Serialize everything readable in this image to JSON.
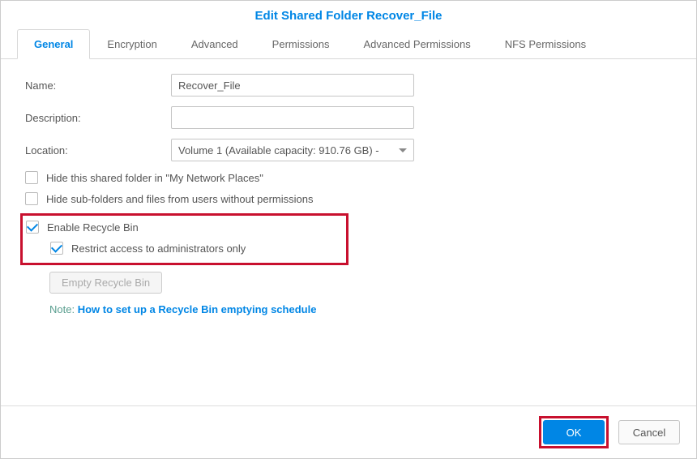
{
  "dialog": {
    "title": "Edit Shared Folder Recover_File"
  },
  "tabs": {
    "general": "General",
    "encryption": "Encryption",
    "advanced": "Advanced",
    "permissions": "Permissions",
    "advanced_permissions": "Advanced Permissions",
    "nfs_permissions": "NFS Permissions"
  },
  "form": {
    "name_label": "Name:",
    "name_value": "Recover_File",
    "description_label": "Description:",
    "description_value": "",
    "location_label": "Location:",
    "location_value": "Volume 1 (Available capacity: 910.76 GB) -"
  },
  "checkboxes": {
    "hide_network": "Hide this shared folder in \"My Network Places\"",
    "hide_subfolders": "Hide sub-folders and files from users without permissions",
    "enable_recycle": "Enable Recycle Bin",
    "restrict_admin": "Restrict access to administrators only"
  },
  "buttons": {
    "empty_recycle": "Empty Recycle Bin",
    "ok": "OK",
    "cancel": "Cancel"
  },
  "note": {
    "prefix": "Note: ",
    "link": "How to set up a Recycle Bin emptying schedule"
  }
}
